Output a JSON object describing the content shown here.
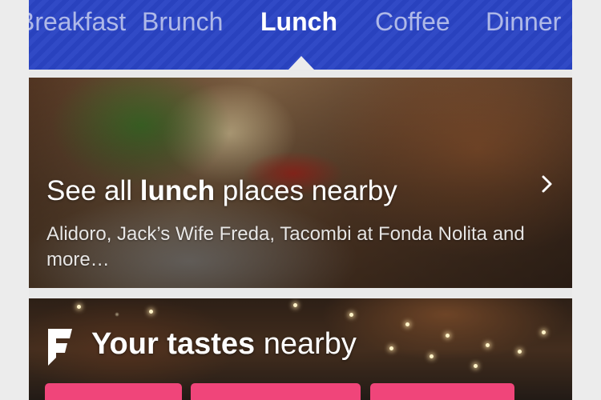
{
  "tabs": {
    "items": [
      {
        "label": "Breakfast",
        "active": false
      },
      {
        "label": "Brunch",
        "active": false
      },
      {
        "label": "Lunch",
        "active": true
      },
      {
        "label": "Coffee",
        "active": false
      },
      {
        "label": "Dinner",
        "active": false
      }
    ],
    "background": "#2a44c4"
  },
  "hero": {
    "title_pre": "See all ",
    "title_bold": "lunch",
    "title_post": " places nearby",
    "subtitle": "Alidoro, Jack’s Wife Freda, Tacombi at Fonda Nolita and more…"
  },
  "tastes": {
    "title_bold": "Your tastes",
    "title_rest": " nearby",
    "pill_color": "#f0457a"
  }
}
